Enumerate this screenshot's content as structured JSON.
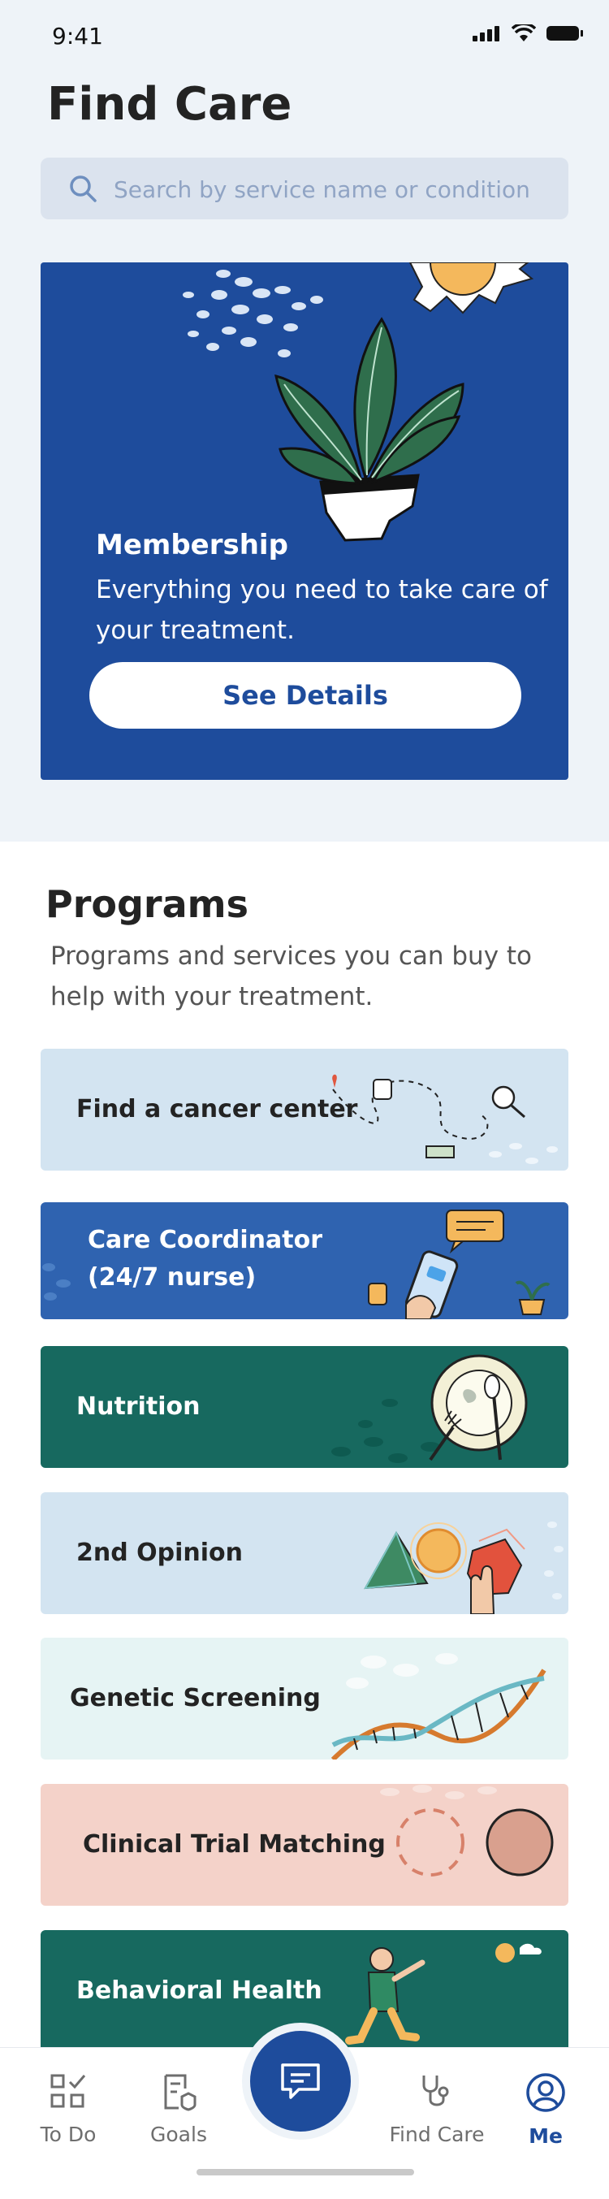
{
  "status_bar": {
    "time": "9:41"
  },
  "page": {
    "title": "Find Care"
  },
  "search": {
    "placeholder": "Search by service name or condition"
  },
  "membership": {
    "title": "Membership",
    "description": "Everything you need to take care of your treatment.",
    "button_label": "See Details"
  },
  "programs": {
    "title": "Programs",
    "description": "Programs and services you can buy to help with your treatment.",
    "cards": [
      {
        "label": "Find a cancer center",
        "bg": "#d3e4f1",
        "fg": "#232323"
      },
      {
        "label": "Care Coordinator\n(24/7 nurse)",
        "bg": "#2f63b0",
        "fg": "#ffffff"
      },
      {
        "label": "Nutrition",
        "bg": "#17695f",
        "fg": "#ffffff"
      },
      {
        "label": "2nd Opinion",
        "bg": "#d3e4f1",
        "fg": "#232323"
      },
      {
        "label": "Genetic Screening",
        "bg": "#e6f4f4",
        "fg": "#232323"
      },
      {
        "label": "Clinical Trial Matching",
        "bg": "#f4d2c9",
        "fg": "#232323"
      },
      {
        "label": "Behavioral Health",
        "bg": "#17695f",
        "fg": "#ffffff"
      }
    ]
  },
  "nav": {
    "items": [
      {
        "label": "To Do",
        "icon": "todo-icon"
      },
      {
        "label": "Goals",
        "icon": "goals-icon"
      },
      {
        "label": "Find Care",
        "icon": "stethoscope-icon"
      },
      {
        "label": "Me",
        "icon": "user-icon"
      }
    ],
    "active": "Me",
    "chat_icon": "chat-icon"
  },
  "colors": {
    "primary": "#1e4c9c",
    "background": "#eef3f8"
  }
}
